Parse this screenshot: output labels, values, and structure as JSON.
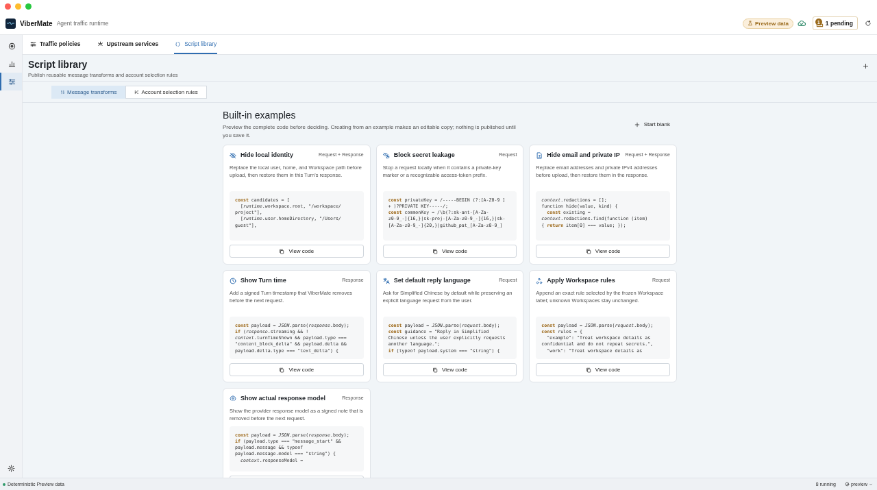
{
  "app": {
    "name": "ViberMate",
    "subtitle": "Agent traffic runtime",
    "badge": "Preview data",
    "pending_count": "1",
    "pending_label": "1 pending"
  },
  "sidebar": {
    "items": [
      {
        "selected": false
      },
      {
        "selected": false
      },
      {
        "selected": true
      }
    ]
  },
  "tabs": [
    {
      "label": "Traffic policies",
      "selected": false
    },
    {
      "label": "Upstream services",
      "selected": false
    },
    {
      "label": "Script library",
      "selected": true
    }
  ],
  "page": {
    "title": "Script library",
    "subtitle": "Publish reusable message transforms and account selection rules"
  },
  "subtabs": [
    {
      "label": "Message transforms",
      "selected": true
    },
    {
      "label": "Account selection rules",
      "selected": false
    }
  ],
  "examples": {
    "title": "Built-in examples",
    "description": "Preview the complete code before deciding. Creating from an example makes an editable copy; nothing is published until you save it.",
    "start_button": "Start blank",
    "cards": [
      {
        "title": "Hide local identity",
        "scope": "Request + Response",
        "description": "Replace the local user, home, and Workspace path before upload, then restore them in this Turn's response.",
        "code": "**const** candidates = [\n  [*runtime*.workspace.root, \"/workspace/\nproject\"],\n  [*runtime*.user.homeDirectory, \"/Users/\nguest\"],",
        "button": "View code"
      },
      {
        "title": "Block secret leakage",
        "scope": "Request",
        "description": "Stop a request locally when it contains a private-key marker or a recognizable access-token prefix.",
        "code": "**const** privateKey = /-----BEGIN (?:[A-Z0-9 ]\n+ )?PRIVATE KEY-----/;\n**const** commonKey = /\\b(?:sk-ant-[A-Za-\nz0-9_-]{16,}|sk-proj-[A-Za-z0-9_-]{16,}|sk-\n[A-Za-z0-9_-]{20,}|github_pat_[A-Za-z0-9_]",
        "button": "View code"
      },
      {
        "title": "Hide email and private IP",
        "scope": "Request + Response",
        "description": "Replace email addresses and private IPv4 addresses before upload, then restore them in the response.",
        "code": "*context*.redactions = [];\nfunction hide(value, kind) {\n  **const** existing =\n*context*.redactions.find(function (item)\n{ **return** item[0] === value; });",
        "button": "View code"
      },
      {
        "title": "Show Turn time",
        "scope": "Response",
        "description": "Add a signed Turn timestamp that ViberMate removes before the next request.",
        "code": "**const** payload = *JSON*.parse(*response*.body);\n**if** (*response*.streaming && !\n*context*.turnTimeShown && payload.type ===\n\"content_block_delta\" && payload.delta &&\npayload.delta.type === \"text_delta\") {",
        "button": "View code"
      },
      {
        "title": "Set default reply language",
        "scope": "Request",
        "description": "Ask for Simplified Chinese by default while preserving an explicit language request from the user.",
        "code": "**const** payload = *JSON*.parse(*request*.body);\n**const** guidance = \"Reply in Simplified\nChinese unless the user explicitly requests\nanother language.\";\n**if** (typeof payload.system === \"string\") {",
        "button": "View code"
      },
      {
        "title": "Apply Workspace rules",
        "scope": "Request",
        "description": "Append an exact rule selected by the frozen Workspace label; unknown Workspaces stay unchanged.",
        "code": "**const** payload = *JSON*.parse(*request*.body);\n**const** rules = {\n  \"example\": \"Treat workspace details as\nconfidential and do not repeat secrets.\",\n  \"work\": \"Treat workspace details as",
        "button": "View code"
      },
      {
        "title": "Show actual response model",
        "scope": "Response",
        "description": "Show the provider response model as a signed note that is removed before the next request.",
        "code": "**const** payload = *JSON*.parse(*response*.body);\n**if** (payload.type === \"message_start\" &&\npayload.message && typeof\npayload.message.model === \"string\") {\n  *context*.responseModel ="
      }
    ]
  },
  "status_bar": {
    "left": "Deterministic Preview data",
    "running": "8 running",
    "mode": "preview"
  }
}
